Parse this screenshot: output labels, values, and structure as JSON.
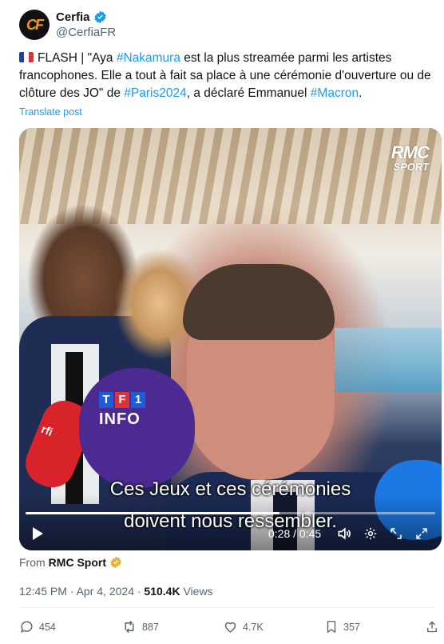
{
  "post": {
    "author": {
      "display_name": "Cerfia",
      "handle": "@CerfiaFR",
      "avatar_text": "CF"
    },
    "text": {
      "part1": "FLASH | \"Aya ",
      "hashtag1": "#Nakamura",
      "part2": " est la plus streamée parmi les artistes francophones. Elle a tout à fait sa place à une cérémonie d'ouverture ou de clôture des JO\" de ",
      "hashtag2": "#Paris2024",
      "part3": ", a déclaré Emmanuel ",
      "hashtag3": "#Macron",
      "part4": "."
    },
    "translate_label": "Translate post"
  },
  "video": {
    "watermark_line1": "RMC",
    "watermark_line2": "SPORT",
    "mic_label_rfi": "rfi",
    "mic_label_tf1": [
      "T",
      "F",
      "1"
    ],
    "mic_label_info": "INFO",
    "caption_line1": "Ces Jeux et ces cérémonies",
    "caption_line2": "doivent nous ressembler.",
    "time": "0:28 / 0:45",
    "progress": 0.62
  },
  "source": {
    "from_label": "From",
    "name": "RMC Sport"
  },
  "meta": {
    "timestamp": "12:45 PM · Apr 4, 2024 · ",
    "views_count": "510.4K",
    "views_label": " Views"
  },
  "actions": {
    "replies": "454",
    "reposts": "887",
    "likes": "4.7K",
    "bookmarks": "357"
  },
  "colors": {
    "accent": "#1d9bf0",
    "text": "#0f1419",
    "muted": "#536471",
    "gold": "#e8b33a"
  }
}
